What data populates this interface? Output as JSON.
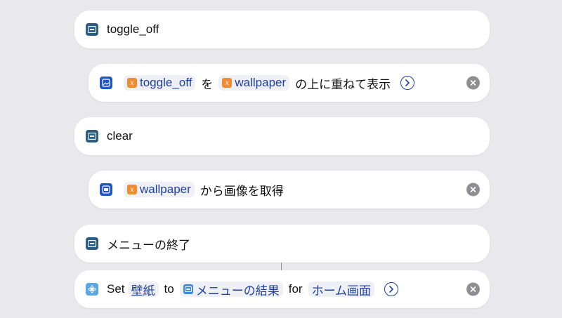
{
  "actions": [
    {
      "title": "toggle_off"
    },
    {
      "var1": "toggle_off",
      "particle1": "を",
      "var2": "wallpaper",
      "suffix": "の上に重ねて表示"
    },
    {
      "title": "clear"
    },
    {
      "var": "wallpaper",
      "suffix": "から画像を取得"
    },
    {
      "title": "メニューの終了"
    },
    {
      "set": "Set",
      "var": "壁紙",
      "to": "to",
      "value": "メニューの結果",
      "for": "for",
      "target": "ホーム画面"
    }
  ],
  "icons": {
    "menu_item": "menu-item-icon",
    "overlay": "image-overlay-icon",
    "get_image": "get-image-icon",
    "wallpaper_set": "wallpaper-set-icon",
    "variable": "variable-icon",
    "chevron": "chevron-right-circle-icon",
    "remove": "remove-icon"
  },
  "colors": {
    "background": "#e8e8ed",
    "token_text": "#1d3fa6",
    "variable_badge": "#f28a2e",
    "remove_button": "#8e8e93"
  }
}
